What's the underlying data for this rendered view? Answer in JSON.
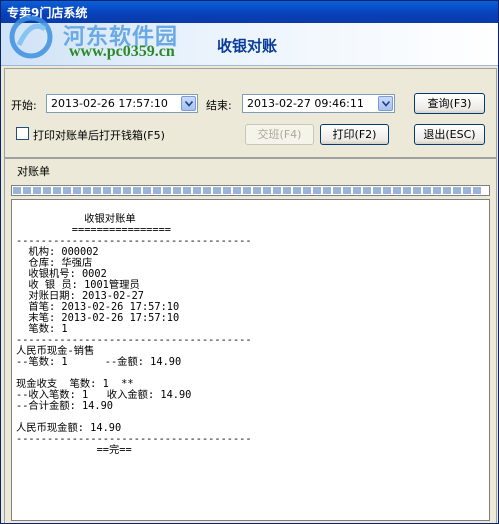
{
  "window": {
    "title": "专卖9门店系统",
    "heading": "收银对账"
  },
  "watermark": {
    "name": "河东软件园",
    "url": "www.pc0359.cn"
  },
  "filters": {
    "start_label": "开始:",
    "start_value": "2013-02-26 17:57:10",
    "end_label": "结束:",
    "end_value": "2013-02-27 09:46:11",
    "checkbox_label": "打印对账单后打开钱箱(F5)",
    "checkbox_checked": false
  },
  "buttons": {
    "query": "查询(F3)",
    "handover": "交班(F4)",
    "print": "打印(F2)",
    "exit": "退出(ESC)"
  },
  "panel": {
    "title": "对账单",
    "progress": 0.99
  },
  "receipt": {
    "lines": [
      "           收银对账单",
      "         ================",
      "--------------------------------------",
      "  机构: 000002",
      "  仓库: 华强店",
      "  收银机号: 0002",
      "  收 银 员: 1001管理员",
      "  对账日期: 2013-02-27",
      "  首笔: 2013-02-26 17:57:10",
      "  末笔: 2013-02-26 17:57:10",
      "  笔数: 1",
      "--------------------------------------",
      "人民币现金-销售",
      "--笔数: 1      --金额: 14.90",
      "",
      "现金收支  笔数: 1  **",
      "--收入笔数: 1   收入金额: 14.90",
      "--合计金额: 14.90",
      "",
      "人民币现金额: 14.90",
      "--------------------------------------",
      "             ==完=="
    ]
  }
}
